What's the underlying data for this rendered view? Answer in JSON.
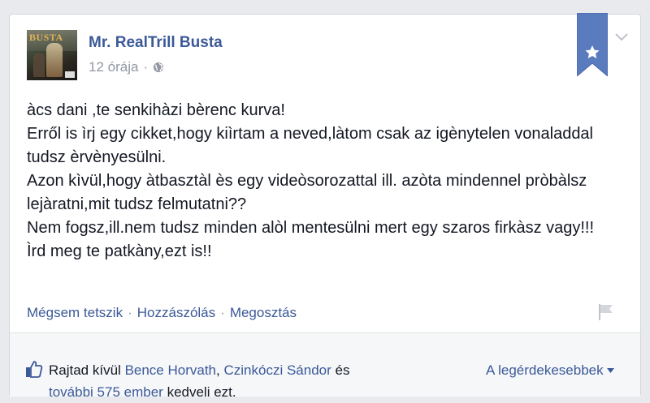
{
  "post": {
    "author": "Mr. RealTrill Busta",
    "avatar_text": "BUSTA",
    "time": "12 órája",
    "separator": "·",
    "body_lines": [
      "àcs dani ,te senkihàzi bèrenc kurva!",
      "Erről is ìrj egy cikket,hogy kiìrtam a neved,làtom csak az igènytelen vonaladdal tudsz èrvènyesülni.",
      "Azon kìvül,hogy àtbasztàl ès egy videòsorozattal ill. azòta mindennel pròbàlsz lejàratni,mit tudsz felmutatni??",
      "Nem fogsz,ill.nem tudsz minden alòl mentesülni mert egy szaros firkàsz vagy!!!",
      "Ìrd meg te patkàny,ezt is!!"
    ]
  },
  "actions": {
    "unlike": "Mégsem tetszik",
    "comment": "Hozzászólás",
    "share": "Megosztás",
    "separator": "·"
  },
  "likes": {
    "prefix": "Rajtad kívül",
    "person1": "Bence Horvath",
    "comma": ",",
    "person2": "Czinkóczi Sándor",
    "and": "és",
    "others": "további 575 ember",
    "suffix": "kedveli ezt.",
    "sort_label": "A legérdekesebbek"
  },
  "colors": {
    "link": "#3b5998",
    "muted": "#9197a3",
    "ribbon": "#5b7bbf",
    "background": "#e9eaed"
  },
  "icons": {
    "privacy": "globe-icon",
    "ribbon": "star-ribbon-icon",
    "menu": "chevron-down-icon",
    "report": "flag-icon",
    "like": "thumbs-up-icon",
    "sort": "caret-down-icon"
  }
}
